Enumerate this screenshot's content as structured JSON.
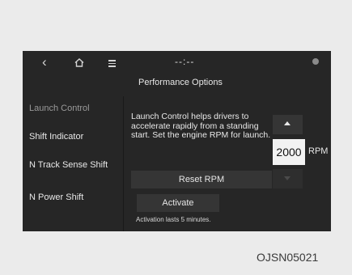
{
  "status_bar": {
    "center_text": "--:--",
    "icons": [
      "back-icon",
      "home-icon",
      "menu-icon",
      "corner-indicator-icon"
    ]
  },
  "page": {
    "title": "Performance Options"
  },
  "sidebar": {
    "items": [
      {
        "label": "Launch Control",
        "active": true
      },
      {
        "label": "Shift Indicator",
        "active": false
      },
      {
        "label": "N Track Sense Shift",
        "active": false
      },
      {
        "label": "N Power Shift",
        "active": false
      }
    ]
  },
  "main": {
    "description": "Launch Control helps drivers to accelerate rapidly from a standing start. Set the engine RPM for launch.",
    "reset_label": "Reset RPM",
    "activate_label": "Activate",
    "note": "Activation lasts 5 minutes."
  },
  "rpm": {
    "value": "2000",
    "unit": "RPM",
    "decrease_enabled": false
  },
  "caption": "OJSN05021"
}
